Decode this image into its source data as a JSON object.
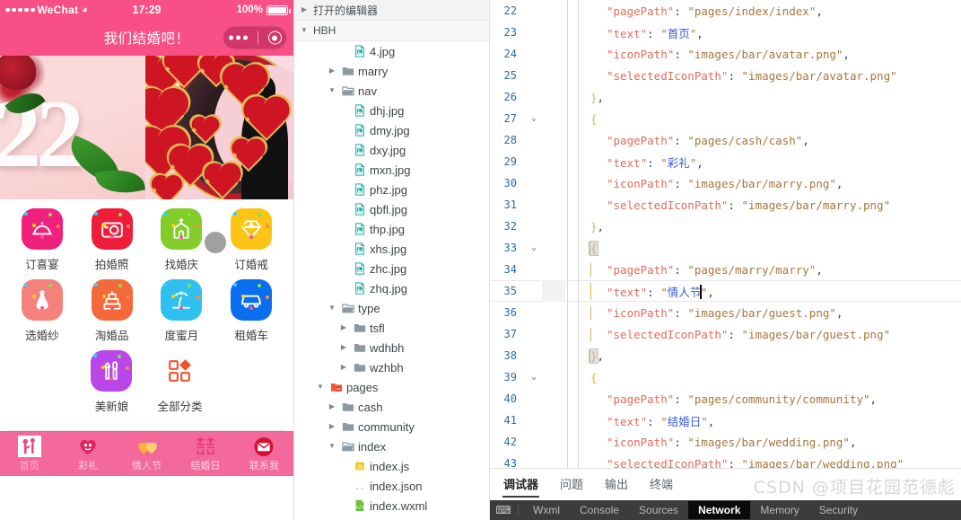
{
  "phone": {
    "status": {
      "carrier": "WeChat",
      "wifi_icon": "wifi-icon",
      "time": "17:29",
      "battery_percent": "100%"
    },
    "nav": {
      "title": "我们结婚吧！"
    },
    "banner": {
      "left_number": "22"
    },
    "grid": [
      {
        "label": "订喜宴",
        "icon": "dish-cover-icon",
        "color": "#f0207c"
      },
      {
        "label": "拍婚照",
        "icon": "camera-icon",
        "color": "#ef1c3a"
      },
      {
        "label": "找婚庆",
        "icon": "church-icon",
        "color": "#82cd2a"
      },
      {
        "label": "订婚戒",
        "icon": "diamond-ring-icon",
        "color": "#fcc415"
      },
      {
        "label": "选婚纱",
        "icon": "wedding-dress-icon",
        "color": "#f4817c"
      },
      {
        "label": "淘婚品",
        "icon": "wedding-cake-icon",
        "color": "#f4693c"
      },
      {
        "label": "度蜜月",
        "icon": "palm-island-icon",
        "color": "#2ec0f0"
      },
      {
        "label": "租婚车",
        "icon": "car-icon",
        "color": "#0a6ef0"
      }
    ],
    "grid_tail": [
      {
        "label": "美新娘",
        "icon": "makeup-icon",
        "color": "#b946e8"
      },
      {
        "label": "全部分类",
        "icon": "all-categories-icon",
        "color": "#f0552f"
      }
    ],
    "tabbar": [
      {
        "label": "首页",
        "icon": "home-hearts-icon",
        "active": true
      },
      {
        "label": "彩礼",
        "icon": "heart-couple-icon",
        "active": false
      },
      {
        "label": "情人节",
        "icon": "double-heart-icon",
        "active": false
      },
      {
        "label": "结婚日",
        "icon": "double-happiness-icon",
        "active": false
      },
      {
        "label": "联系我",
        "icon": "mail-icon",
        "active": false
      }
    ]
  },
  "tree": {
    "open_editors_label": "打开的编辑器",
    "project_label": "HBH",
    "items": [
      {
        "label": "4.jpg",
        "indent": 3,
        "kind": "image",
        "twisty": ""
      },
      {
        "label": "marry",
        "indent": 2,
        "kind": "folder",
        "twisty": "collapsed"
      },
      {
        "label": "nav",
        "indent": 2,
        "kind": "folder-open",
        "twisty": "expanded"
      },
      {
        "label": "dhj.jpg",
        "indent": 3,
        "kind": "image",
        "twisty": ""
      },
      {
        "label": "dmy.jpg",
        "indent": 3,
        "kind": "image",
        "twisty": ""
      },
      {
        "label": "dxy.jpg",
        "indent": 3,
        "kind": "image",
        "twisty": ""
      },
      {
        "label": "mxn.jpg",
        "indent": 3,
        "kind": "image",
        "twisty": ""
      },
      {
        "label": "phz.jpg",
        "indent": 3,
        "kind": "image",
        "twisty": ""
      },
      {
        "label": "qbfl.jpg",
        "indent": 3,
        "kind": "image",
        "twisty": ""
      },
      {
        "label": "thp.jpg",
        "indent": 3,
        "kind": "image",
        "twisty": ""
      },
      {
        "label": "xhs.jpg",
        "indent": 3,
        "kind": "image",
        "twisty": ""
      },
      {
        "label": "zhc.jpg",
        "indent": 3,
        "kind": "image",
        "twisty": ""
      },
      {
        "label": "zhq.jpg",
        "indent": 3,
        "kind": "image",
        "twisty": ""
      },
      {
        "label": "type",
        "indent": 2,
        "kind": "folder-open",
        "twisty": "expanded"
      },
      {
        "label": "tsfl",
        "indent": 3,
        "kind": "folder",
        "twisty": "collapsed"
      },
      {
        "label": "wdhbh",
        "indent": 3,
        "kind": "folder",
        "twisty": "collapsed"
      },
      {
        "label": "wzhbh",
        "indent": 3,
        "kind": "folder",
        "twisty": "collapsed"
      },
      {
        "label": "pages",
        "indent": 1,
        "kind": "folder-pages",
        "twisty": "expanded"
      },
      {
        "label": "cash",
        "indent": 2,
        "kind": "folder",
        "twisty": "collapsed"
      },
      {
        "label": "community",
        "indent": 2,
        "kind": "folder",
        "twisty": "collapsed"
      },
      {
        "label": "index",
        "indent": 2,
        "kind": "folder-open",
        "twisty": "expanded"
      },
      {
        "label": "index.js",
        "indent": 3,
        "kind": "js",
        "twisty": ""
      },
      {
        "label": "index.json",
        "indent": 3,
        "kind": "json",
        "twisty": ""
      },
      {
        "label": "index.wxml",
        "indent": 3,
        "kind": "wxml",
        "twisty": ""
      }
    ]
  },
  "editor": {
    "active_line": 35,
    "lines": [
      {
        "n": 22,
        "fold": "",
        "indent": 3,
        "tokens": [
          {
            "t": "\"pagePath\"",
            "c": "k"
          },
          {
            "t": ": ",
            "c": "p"
          },
          {
            "t": "\"pages/index/index\"",
            "c": "s"
          },
          {
            "t": ",",
            "c": "p"
          }
        ]
      },
      {
        "n": 23,
        "fold": "",
        "indent": 3,
        "tokens": [
          {
            "t": "\"text\"",
            "c": "k"
          },
          {
            "t": ": ",
            "c": "p"
          },
          {
            "t": "\"",
            "c": "s"
          },
          {
            "t": "首页",
            "c": "cn"
          },
          {
            "t": "\"",
            "c": "s"
          },
          {
            "t": ",",
            "c": "p"
          }
        ]
      },
      {
        "n": 24,
        "fold": "",
        "indent": 3,
        "tokens": [
          {
            "t": "\"iconPath\"",
            "c": "k"
          },
          {
            "t": ": ",
            "c": "p"
          },
          {
            "t": "\"images/bar/avatar.png\"",
            "c": "s"
          },
          {
            "t": ",",
            "c": "p"
          }
        ]
      },
      {
        "n": 25,
        "fold": "",
        "indent": 3,
        "tokens": [
          {
            "t": "\"selectedIconPath\"",
            "c": "k"
          },
          {
            "t": ": ",
            "c": "p"
          },
          {
            "t": "\"images/bar/avatar.png\"",
            "c": "s"
          }
        ]
      },
      {
        "n": 26,
        "fold": "",
        "indent": 2,
        "tokens": [
          {
            "t": "}",
            "c": "br"
          },
          {
            "t": ",",
            "c": "p"
          }
        ]
      },
      {
        "n": 27,
        "fold": "expanded",
        "indent": 2,
        "tokens": [
          {
            "t": "{",
            "c": "br"
          }
        ]
      },
      {
        "n": 28,
        "fold": "",
        "indent": 3,
        "tokens": [
          {
            "t": "\"pagePath\"",
            "c": "k"
          },
          {
            "t": ": ",
            "c": "p"
          },
          {
            "t": "\"pages/cash/cash\"",
            "c": "s"
          },
          {
            "t": ",",
            "c": "p"
          }
        ]
      },
      {
        "n": 29,
        "fold": "",
        "indent": 3,
        "tokens": [
          {
            "t": "\"text\"",
            "c": "k"
          },
          {
            "t": ": ",
            "c": "p"
          },
          {
            "t": "\"",
            "c": "s"
          },
          {
            "t": "彩礼",
            "c": "cn"
          },
          {
            "t": "\"",
            "c": "s"
          },
          {
            "t": ",",
            "c": "p"
          }
        ]
      },
      {
        "n": 30,
        "fold": "",
        "indent": 3,
        "tokens": [
          {
            "t": "\"iconPath\"",
            "c": "k"
          },
          {
            "t": ": ",
            "c": "p"
          },
          {
            "t": "\"images/bar/marry.png\"",
            "c": "s"
          },
          {
            "t": ",",
            "c": "p"
          }
        ]
      },
      {
        "n": 31,
        "fold": "",
        "indent": 3,
        "tokens": [
          {
            "t": "\"selectedIconPath\"",
            "c": "k"
          },
          {
            "t": ": ",
            "c": "p"
          },
          {
            "t": "\"images/bar/marry.png\"",
            "c": "s"
          }
        ]
      },
      {
        "n": 32,
        "fold": "",
        "indent": 2,
        "tokens": [
          {
            "t": "}",
            "c": "br"
          },
          {
            "t": ",",
            "c": "p"
          }
        ]
      },
      {
        "n": 33,
        "fold": "expanded",
        "indent": 2,
        "tokens": [
          {
            "t": "{",
            "c": "br",
            "hl": true
          }
        ]
      },
      {
        "n": 34,
        "fold": "",
        "indent": 3,
        "tokens": [
          {
            "t": "\"pagePath\"",
            "c": "k"
          },
          {
            "t": ": ",
            "c": "p"
          },
          {
            "t": "\"pages/marry/marry\"",
            "c": "s"
          },
          {
            "t": ",",
            "c": "p"
          }
        ]
      },
      {
        "n": 35,
        "fold": "",
        "indent": 3,
        "tokens": [
          {
            "t": "\"text\"",
            "c": "k"
          },
          {
            "t": ": ",
            "c": "p"
          },
          {
            "t": "\"",
            "c": "s"
          },
          {
            "t": "情人节",
            "c": "cn",
            "caret": true
          },
          {
            "t": "\"",
            "c": "s"
          },
          {
            "t": ",",
            "c": "p"
          }
        ]
      },
      {
        "n": 36,
        "fold": "",
        "indent": 3,
        "tokens": [
          {
            "t": "\"iconPath\"",
            "c": "k"
          },
          {
            "t": ": ",
            "c": "p"
          },
          {
            "t": "\"images/bar/guest.png\"",
            "c": "s"
          },
          {
            "t": ",",
            "c": "p"
          }
        ]
      },
      {
        "n": 37,
        "fold": "",
        "indent": 3,
        "tokens": [
          {
            "t": "\"selectedIconPath\"",
            "c": "k"
          },
          {
            "t": ": ",
            "c": "p"
          },
          {
            "t": "\"images/bar/guest.png\"",
            "c": "s"
          }
        ]
      },
      {
        "n": 38,
        "fold": "",
        "indent": 2,
        "tokens": [
          {
            "t": "}",
            "c": "br",
            "hl": true
          },
          {
            "t": ",",
            "c": "p"
          }
        ]
      },
      {
        "n": 39,
        "fold": "expanded",
        "indent": 2,
        "tokens": [
          {
            "t": "{",
            "c": "br"
          }
        ]
      },
      {
        "n": 40,
        "fold": "",
        "indent": 3,
        "tokens": [
          {
            "t": "\"pagePath\"",
            "c": "k"
          },
          {
            "t": ": ",
            "c": "p"
          },
          {
            "t": "\"pages/community/community\"",
            "c": "s"
          },
          {
            "t": ",",
            "c": "p"
          }
        ]
      },
      {
        "n": 41,
        "fold": "",
        "indent": 3,
        "tokens": [
          {
            "t": "\"text\"",
            "c": "k"
          },
          {
            "t": ": ",
            "c": "p"
          },
          {
            "t": "\"",
            "c": "s"
          },
          {
            "t": "结婚日",
            "c": "cn"
          },
          {
            "t": "\"",
            "c": "s"
          },
          {
            "t": ",",
            "c": "p"
          }
        ]
      },
      {
        "n": 42,
        "fold": "",
        "indent": 3,
        "tokens": [
          {
            "t": "\"iconPath\"",
            "c": "k"
          },
          {
            "t": ": ",
            "c": "p"
          },
          {
            "t": "\"images/bar/wedding.png\"",
            "c": "s"
          },
          {
            "t": ",",
            "c": "p"
          }
        ]
      },
      {
        "n": 43,
        "fold": "",
        "indent": 3,
        "tokens": [
          {
            "t": "\"selectedIconPath\"",
            "c": "k"
          },
          {
            "t": ": ",
            "c": "p"
          },
          {
            "t": "\"images/bar/wedding.png\"",
            "c": "s"
          }
        ]
      }
    ]
  },
  "bottom_panel": {
    "tabs": [
      {
        "label": "调试器",
        "active": true
      },
      {
        "label": "问题",
        "active": false
      },
      {
        "label": "输出",
        "active": false
      },
      {
        "label": "终端",
        "active": false
      }
    ],
    "watermark": "CSDN @项目花园范德彪"
  },
  "devtools": {
    "inspect_icon": "inspect-element-icon",
    "tabs": [
      {
        "label": "Wxml",
        "active": false
      },
      {
        "label": "Console",
        "active": false
      },
      {
        "label": "Sources",
        "active": false
      },
      {
        "label": "Network",
        "active": true
      },
      {
        "label": "Memory",
        "active": false
      },
      {
        "label": "Security",
        "active": false
      }
    ]
  }
}
